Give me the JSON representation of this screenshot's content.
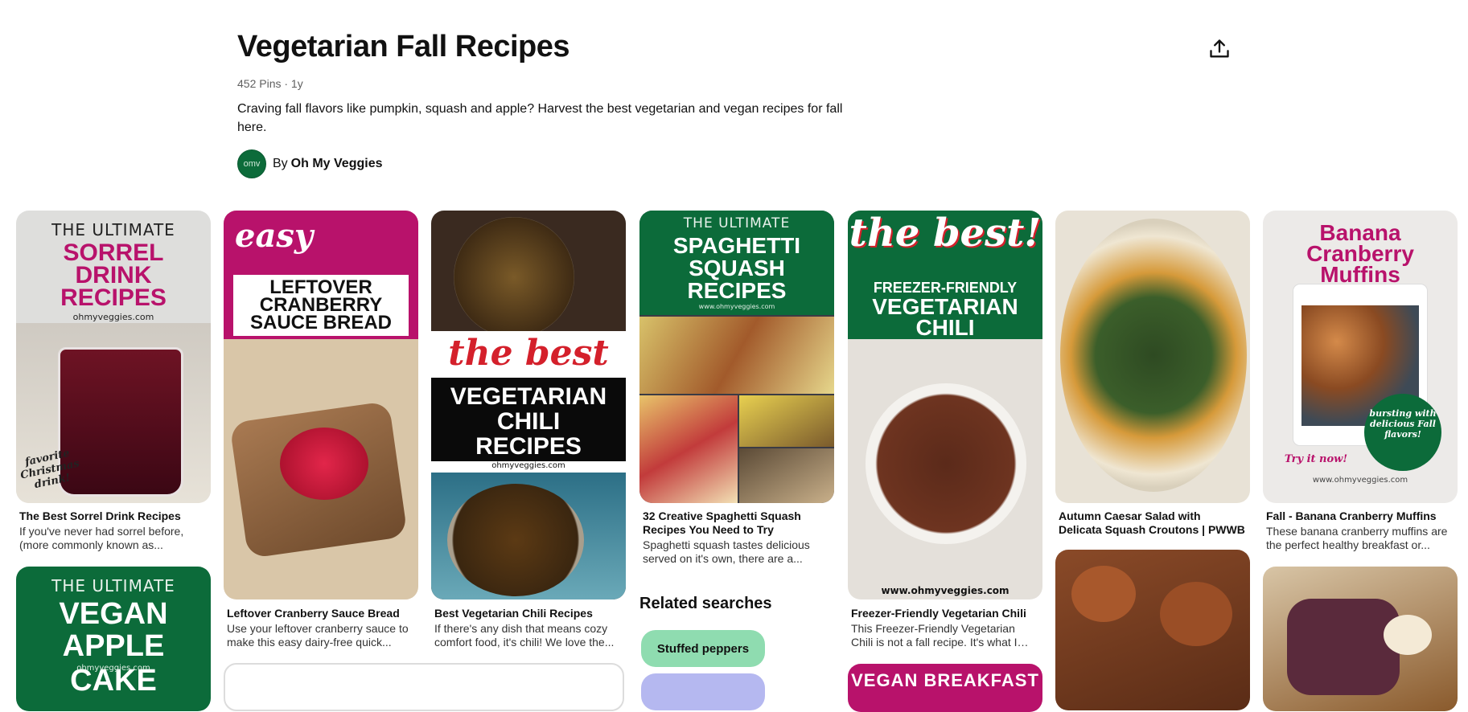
{
  "board": {
    "title": "Vegetarian Fall Recipes",
    "meta": "452 Pins · 1y",
    "description": "Craving fall flavors like pumpkin, squash and apple? Harvest the best vegetarian and vegan recipes for fall here.",
    "owner_prefix": "By",
    "owner_name": "Oh My Veggies",
    "owner_avatar": "omv"
  },
  "icons": {
    "share": "share-upload-icon"
  },
  "pins": [
    {
      "image_text": {
        "l1": "THE ULTIMATE",
        "l2": "SORREL",
        "l3": "DRINK",
        "l4": "RECIPES",
        "site": "ohmyveggies.com",
        "note": "favorite Christmas drink!"
      },
      "title": "The Best Sorrel Drink Recipes",
      "desc": "If you've never had sorrel before, (more commonly known as..."
    },
    {
      "image_text": {
        "l1": "easy",
        "l2": "LEFTOVER",
        "l3": "CRANBERRY",
        "l4": "SAUCE BREAD"
      },
      "title": "Leftover Cranberry Sauce Bread",
      "desc": "Use your leftover cranberry sauce to make this easy dairy-free quick..."
    },
    {
      "image_text": {
        "l1": "the best",
        "l2": "VEGETARIAN",
        "l3": "CHILI",
        "l4": "RECIPES",
        "site": "ohmyveggies.com"
      },
      "title": "Best Vegetarian Chili Recipes",
      "desc": "If there's any dish that means cozy comfort food, it's chili! We love the..."
    },
    {
      "image_text": {
        "l1": "THE ULTIMATE",
        "l2": "SPAGHETTI",
        "l3": "SQUASH",
        "l4": "RECIPES",
        "site": "www.ohmyveggies.com"
      },
      "title": "32 Creative Spaghetti Squash Recipes You Need to Try",
      "desc": "Spaghetti squash tastes delicious served on it's own, there are a..."
    },
    {
      "image_text": {
        "l1": "the best!",
        "l2": "FREEZER-FRIENDLY",
        "l3": "VEGETARIAN",
        "l4": "CHILI",
        "site": "www.ohmyveggies.com"
      },
      "title": "Freezer-Friendly Vegetarian Chili",
      "desc": "This Freezer-Friendly Vegetarian Chili is not a fall recipe. It's what I lik..."
    },
    {
      "image_text": {},
      "title": "Autumn Caesar Salad with Delicata Squash Croutons | PWWB",
      "desc": ""
    },
    {
      "image_text": {
        "l1": "Banana",
        "l2": "Cranberry",
        "l3": "Muffins",
        "badge": "bursting with delicious Fall flavors!",
        "cta": "Try it now!",
        "site": "www.ohmyveggies.com"
      },
      "title": "Fall - Banana Cranberry Muffins",
      "desc": "These banana cranberry muffins are the perfect healthy breakfast or..."
    },
    {
      "image_text": {
        "l1": "THE ULTIMATE",
        "l2": "VEGAN",
        "l3": "APPLE CAKE",
        "site": "ohmyveggies.com"
      }
    },
    {
      "image_text": {
        "l1": "VEGAN BREAKFAST"
      }
    }
  ],
  "related": {
    "title": "Related searches",
    "chips": [
      {
        "label": "Stuffed peppers",
        "color": "#8fdcb0"
      },
      {
        "label": "",
        "color": "#b5b8f0"
      }
    ]
  },
  "colors": {
    "accent_green": "#0c6b3a",
    "accent_magenta": "#b8126b",
    "chip_green": "#8fdcb0"
  }
}
